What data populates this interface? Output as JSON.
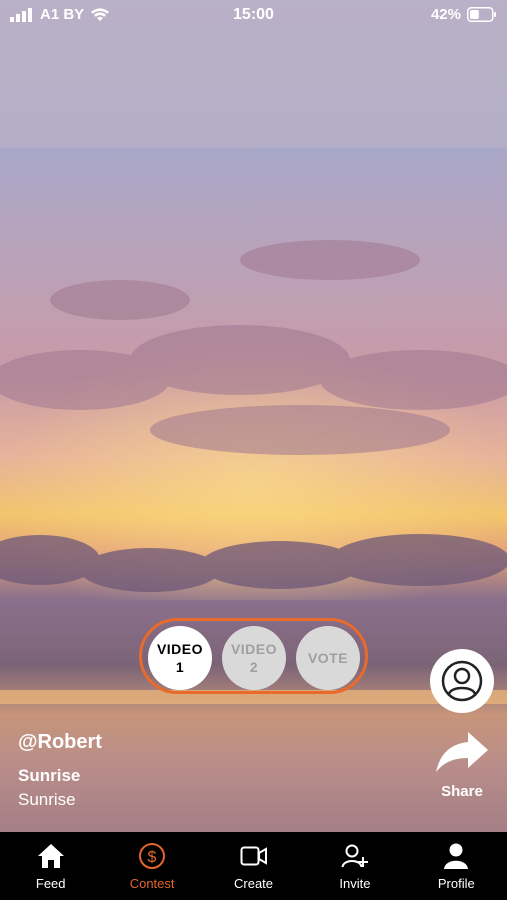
{
  "status_bar": {
    "carrier": "A1 BY",
    "time": "15:00",
    "battery": "42%",
    "battery_level": 0.42
  },
  "segment": {
    "video1_line1": "VIDEO",
    "video1_line2": "1",
    "video2_line1": "VIDEO",
    "video2_line2": "2",
    "vote": "VOTE"
  },
  "post": {
    "username": "@Robert",
    "title": "Sunrise",
    "description": "Sunrise"
  },
  "actions": {
    "share_label": "Share"
  },
  "tabs": [
    {
      "label": "Feed",
      "icon": "home-icon"
    },
    {
      "label": "Contest",
      "icon": "dollar-icon",
      "active": true
    },
    {
      "label": "Create",
      "icon": "video-icon"
    },
    {
      "label": "Invite",
      "icon": "add-user-icon"
    },
    {
      "label": "Profile",
      "icon": "user-icon"
    }
  ],
  "colors": {
    "accent": "#e96a2a",
    "tab_bar": "#000000"
  }
}
